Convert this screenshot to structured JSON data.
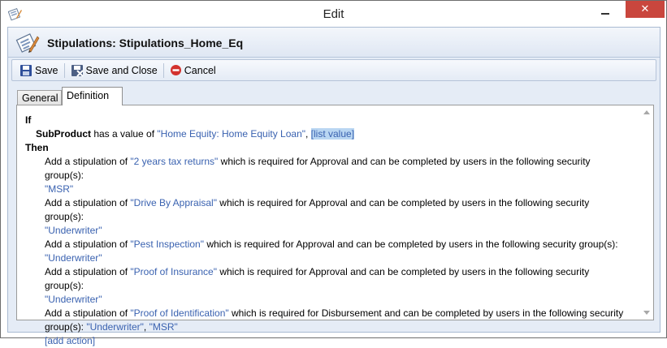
{
  "window": {
    "title": "Edit",
    "minimize_glyph": "—",
    "close_glyph": "✕",
    "app_icon": "rules-editor-icon"
  },
  "header": {
    "title": "Stipulations: Stipulations_Home_Eq",
    "icon": "document-pen-icon"
  },
  "toolbar": {
    "save_label": "Save",
    "save_close_label": "Save and Close",
    "cancel_label": "Cancel"
  },
  "tabs": {
    "general": "General",
    "definition": "Definition"
  },
  "rule": {
    "if_keyword": "If",
    "condition": {
      "field": "SubProduct",
      "text": " has a value of ",
      "value": "\"Home Equity: Home Equity Loan\"",
      "separator": ", ",
      "list_link": "[list value]"
    },
    "then_keyword": "Then",
    "actions": [
      {
        "prefix": "Add a stipulation of ",
        "name": "\"2 years tax returns\"",
        "middle": " which is required for Approval and can be completed by users in the following security group(s):",
        "groups": "\"MSR\""
      },
      {
        "prefix": "Add a stipulation of ",
        "name": "\"Drive By Appraisal\"",
        "middle": " which is required for Approval and can be completed by users in the following security group(s):",
        "groups": "\"Underwriter\""
      },
      {
        "prefix": "Add a stipulation of ",
        "name": "\"Pest Inspection\"",
        "middle": " which is required for Approval and can be completed by users in the following security group(s):",
        "groups": "\"Underwriter\""
      },
      {
        "prefix": "Add a stipulation of ",
        "name": "\"Proof of Insurance\"",
        "middle": " which is required for Approval and can be completed by users in the following security group(s):",
        "groups": "\"Underwriter\""
      }
    ],
    "last_action": {
      "prefix": "Add a stipulation of ",
      "name": "\"Proof of Identification\"",
      "middle": " which is required for Disbursement and can be completed by users in the following security",
      "line2_text": " group(s): ",
      "group1": "\"Underwriter\"",
      "sep": ", ",
      "group2": "\"MSR\""
    },
    "add_action": "[add action]"
  },
  "colors": {
    "link": "#3a62b0",
    "close_button": "#c9463d",
    "chrome_bg": "#e5ecf6"
  }
}
